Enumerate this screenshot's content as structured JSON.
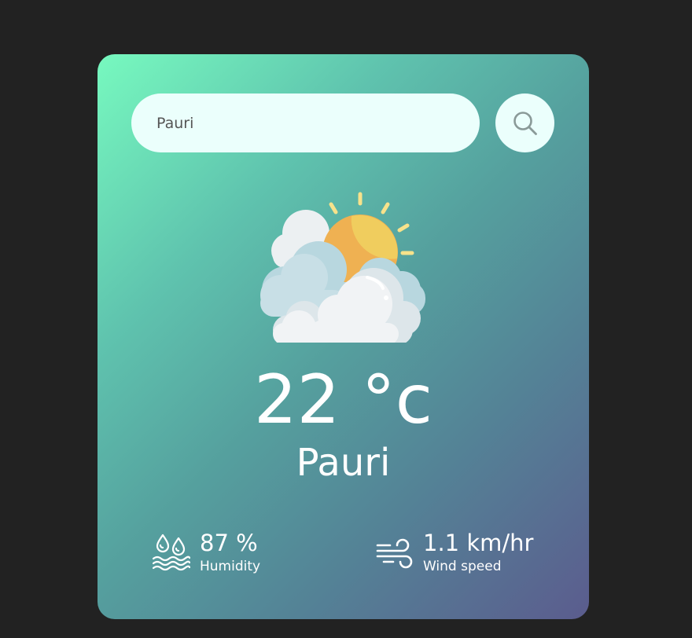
{
  "search": {
    "value": "Pauri",
    "placeholder": ""
  },
  "weather": {
    "icon": "partly-cloudy-sun-icon",
    "temperature": "22 °c",
    "city": "Pauri"
  },
  "details": {
    "humidity": {
      "value": "87 %",
      "label": "Humidity",
      "icon": "humidity-icon"
    },
    "wind": {
      "value": "1.1 km/hr",
      "label": "Wind speed",
      "icon": "wind-icon"
    }
  },
  "colors": {
    "page_background": "#222222",
    "gradient_start": "#77f9bf",
    "gradient_end": "#5b5c8e",
    "input_background": "#ebfffc",
    "text": "#ffffff"
  }
}
